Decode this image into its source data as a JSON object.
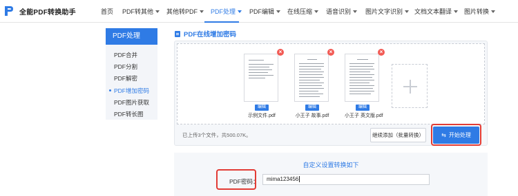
{
  "app": {
    "title": "全能PDF转换助手"
  },
  "nav": {
    "items": [
      {
        "label": "首页",
        "caret": false
      },
      {
        "label": "PDF转其他",
        "caret": true
      },
      {
        "label": "其他转PDF",
        "caret": true
      },
      {
        "label": "PDF处理",
        "caret": true,
        "active": true
      },
      {
        "label": "PDF编辑",
        "caret": true
      },
      {
        "label": "在线压缩",
        "caret": true
      },
      {
        "label": "语音识别",
        "caret": true
      },
      {
        "label": "图片文字识别",
        "caret": true
      },
      {
        "label": "文档文本翻译",
        "caret": true
      },
      {
        "label": "图片转换",
        "caret": true
      }
    ]
  },
  "sidebar": {
    "header": "PDF处理",
    "items": [
      {
        "label": "PDF合并"
      },
      {
        "label": "PDF分割"
      },
      {
        "label": "PDF解密"
      },
      {
        "label": "PDF增加密码",
        "active": true
      },
      {
        "label": "PDF图片获取"
      },
      {
        "label": "PDF转长图"
      }
    ]
  },
  "main": {
    "section_title": "PDF在线增加密码",
    "files": [
      {
        "name": "示例文件.pdf",
        "edit_label": "编辑"
      },
      {
        "name": "小王子 故事.pdf",
        "edit_label": "编辑"
      },
      {
        "name": "小王子 英文版.pdf",
        "edit_label": "编辑"
      }
    ],
    "upload_status": "已上传3个文件，共500.07K。",
    "continue_button": "继续添加（批量转换）",
    "start_button": "开始处理",
    "settings": {
      "title": "自定义设置转换如下",
      "password_label": "PDF密码：",
      "password_value": "mima123456"
    }
  },
  "colors": {
    "accent": "#2f7be5",
    "highlight": "#e23b34",
    "delete": "#f25a54"
  }
}
